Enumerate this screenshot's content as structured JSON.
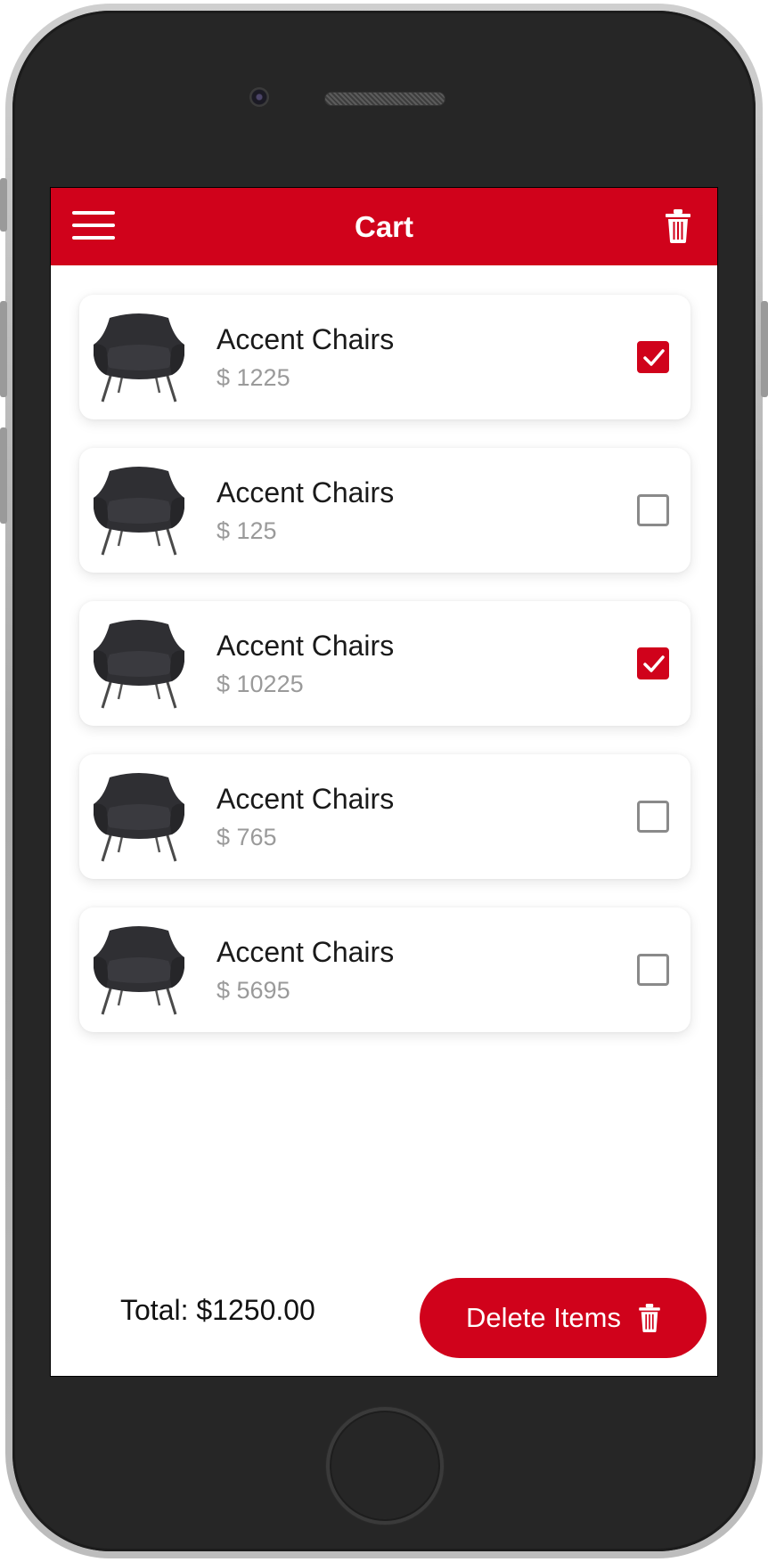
{
  "colors": {
    "accent": "#d0021b",
    "price": "#9a9a9a",
    "device": "#262626"
  },
  "header": {
    "title": "Cart",
    "menu_icon": "hamburger-icon",
    "action_icon": "trash-icon"
  },
  "cart": {
    "items": [
      {
        "name": "Accent Chairs",
        "price": "$ 1225",
        "checked": true
      },
      {
        "name": "Accent Chairs",
        "price": "$ 125",
        "checked": false
      },
      {
        "name": "Accent Chairs",
        "price": "$ 10225",
        "checked": true
      },
      {
        "name": "Accent Chairs",
        "price": "$ 765",
        "checked": false
      },
      {
        "name": "Accent Chairs",
        "price": "$ 5695",
        "checked": false
      }
    ]
  },
  "footer": {
    "total": "Total: $1250.00",
    "delete_label": "Delete Items",
    "delete_icon": "trash-icon"
  }
}
